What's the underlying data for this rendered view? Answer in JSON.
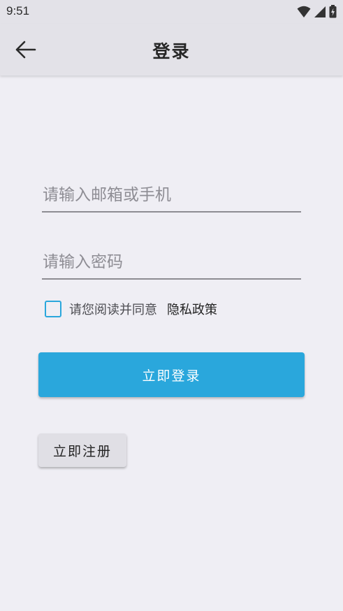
{
  "status_bar": {
    "time": "9:51",
    "icons": [
      "wifi-icon",
      "signal-icon",
      "battery-icon"
    ]
  },
  "app_bar": {
    "title": "登录",
    "back_icon": "arrow-left-icon"
  },
  "form": {
    "email_placeholder": "请输入邮箱或手机",
    "email_value": "",
    "password_placeholder": "请输入密码",
    "password_value": "",
    "agree_text": "请您阅读并同意",
    "policy_link": "隐私政策",
    "agree_checked": false
  },
  "buttons": {
    "login_label": "立即登录",
    "register_label": "立即注册"
  },
  "colors": {
    "accent": "#2aa7dc",
    "background": "#efeef4",
    "app_bar": "#e3e2e8"
  }
}
